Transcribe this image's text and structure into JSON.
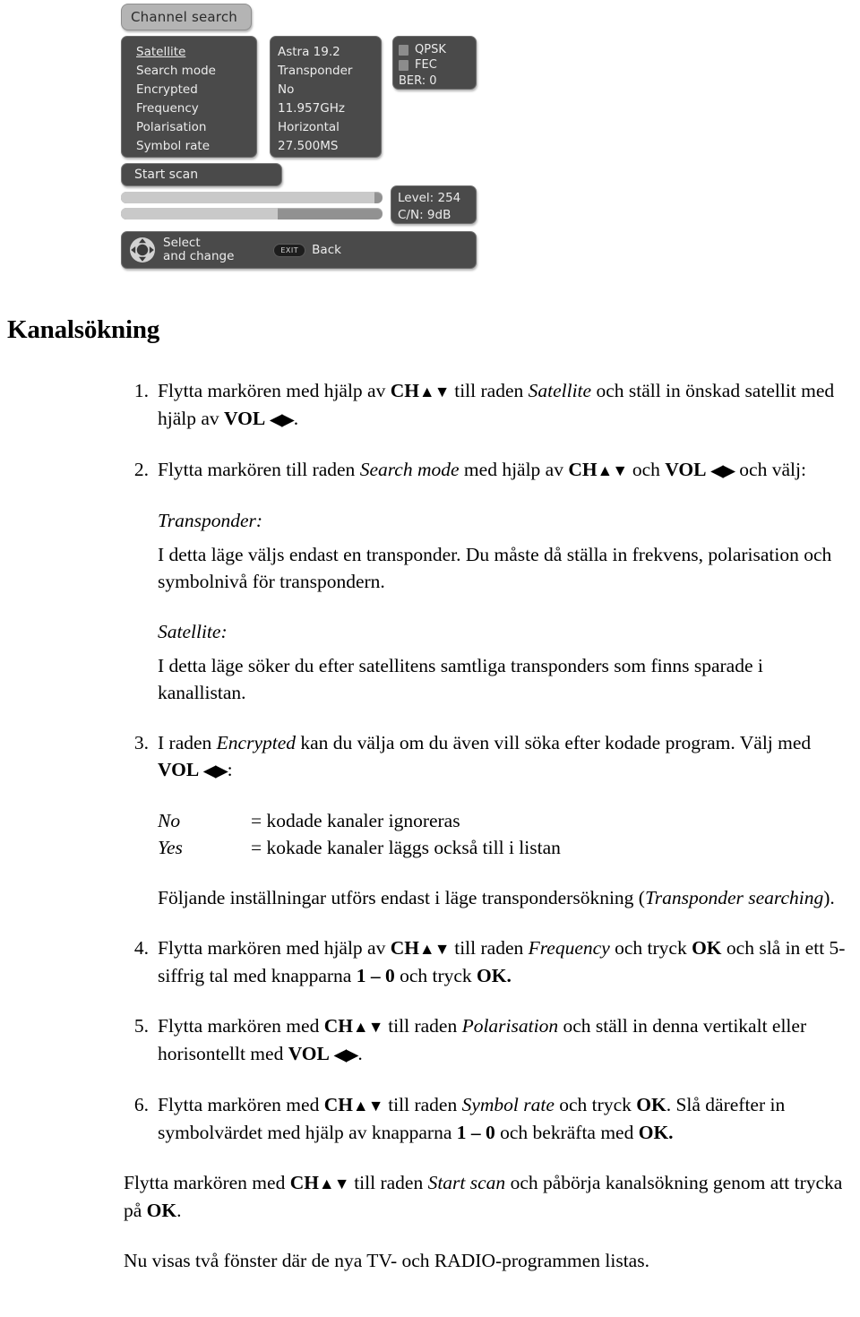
{
  "osd": {
    "title": "Channel search",
    "menu": [
      {
        "label": "Satellite",
        "value": "Astra  19.2",
        "selected": true
      },
      {
        "label": "Search mode",
        "value": "Transponder",
        "selected": false
      },
      {
        "label": "Encrypted",
        "value": "No",
        "selected": false
      },
      {
        "label": "Frequency",
        "value": "11.957GHz",
        "selected": false
      },
      {
        "label": "Polarisation",
        "value": "Horizontal",
        "selected": false
      },
      {
        "label": "Symbol rate",
        "value": "27.500MS",
        "selected": false
      }
    ],
    "modulation": {
      "qpsk_label": "QPSK",
      "fec_label": "FEC",
      "ber_label": "BER: 0"
    },
    "start_scan_label": "Start scan",
    "bars": {
      "top_percent": 97,
      "bottom_percent": 60
    },
    "signal": {
      "level": "Level: 254",
      "cn": "C/N: 9dB"
    },
    "help": {
      "select_label": "Select\nand change",
      "exit_key_label": "EXIT",
      "back_label": "Back"
    },
    "colors": {
      "panel": "#4a4a4a",
      "title_bar": "#b4b4b4",
      "text": "#ececec",
      "bar_track": "#919191",
      "bar_fill": "#c9c9c9"
    }
  },
  "doc": {
    "title": "Kanalsökning",
    "step1": {
      "num": "1.",
      "p1a": "Flytta markören med hjälp av ",
      "ch": "CH",
      "updown": "▲▼",
      "p1b": " till raden ",
      "em1": "Satellite",
      "p1c": " och ställ in önskad satellit med hjälp av ",
      "vol": "VOL",
      "leftright": "◀▶",
      "p1d": "."
    },
    "step2": {
      "num": "2.",
      "p2a": "Flytta markören till raden ",
      "em1": "Search mode",
      "p2b": " med hjälp av ",
      "ch": "CH",
      "updown": "▲▼",
      "p2c": "  och ",
      "vol": "VOL",
      "leftright": "◀▶",
      "p2d": " och välj:"
    },
    "transponder_block": {
      "heading": "Transponder:",
      "body": "I detta läge väljs endast en transponder. Du måste då ställa in frekvens, polarisation och symbolnivå för transpondern."
    },
    "satellite_block": {
      "heading": "Satellite:",
      "body": "I detta läge söker du efter satellitens samtliga transponders som finns sparade i kanallistan."
    },
    "step3": {
      "num": "3.",
      "p3a": "I raden ",
      "em1": "Encrypted",
      "p3b": " kan du välja om du även vill söka efter kodade program. Välj med ",
      "vol": "VOL",
      "leftright": "◀▶",
      "p3c": ":"
    },
    "encrypted_options": [
      {
        "term": "No",
        "desc": "= kodade kanaler ignoreras"
      },
      {
        "term": "Yes",
        "desc": "= kokade kanaler läggs också till i listan"
      }
    ],
    "note_block": {
      "a": "Följande inställningar utförs endast i läge transpondersökning (",
      "em": "Transponder searching",
      "b": ")."
    },
    "step4": {
      "num": "4.",
      "p4a": "Flytta markören med hjälp av ",
      "ch": "CH",
      "updown": "▲▼",
      "p4b": "  till raden ",
      "em1": "Frequency",
      "p4c": " och tryck ",
      "ok1": "OK",
      "p4d": " och slå in ett 5-siffrig tal med knapparna ",
      "keys": "1 – 0",
      "p4e": " och tryck ",
      "ok2": "OK."
    },
    "step5": {
      "num": "5.",
      "p5a": "Flytta markören med ",
      "ch": "CH",
      "updown": "▲▼",
      "p5b": "  till raden ",
      "em1": "Polarisation",
      "p5c": " och ställ in denna vertikalt eller horisontellt med ",
      "vol": "VOL",
      "leftright": "◀▶",
      "p5d": "."
    },
    "step6": {
      "num": "6.",
      "p6a": "Flytta markören med ",
      "ch": "CH",
      "updown": "▲▼",
      "p6b": "  till raden ",
      "em1": "Symbol rate",
      "p6c": " och tryck ",
      "ok1": "OK",
      "p6d": ". Slå därefter in symbolvärdet med hjälp av knapparna ",
      "keys": "1 – 0",
      "p6e": " och bekräfta med ",
      "ok2": "OK."
    },
    "final_block": {
      "a": "Flytta markören med ",
      "ch": "CH",
      "updown": "▲▼",
      "b": "  till raden ",
      "em": "Start scan",
      "c": " och påbörja kanalsökning genom att trycka på ",
      "ok": "OK",
      "d": "."
    },
    "closing": "Nu visas två fönster där de nya TV- och RADIO-programmen listas."
  }
}
